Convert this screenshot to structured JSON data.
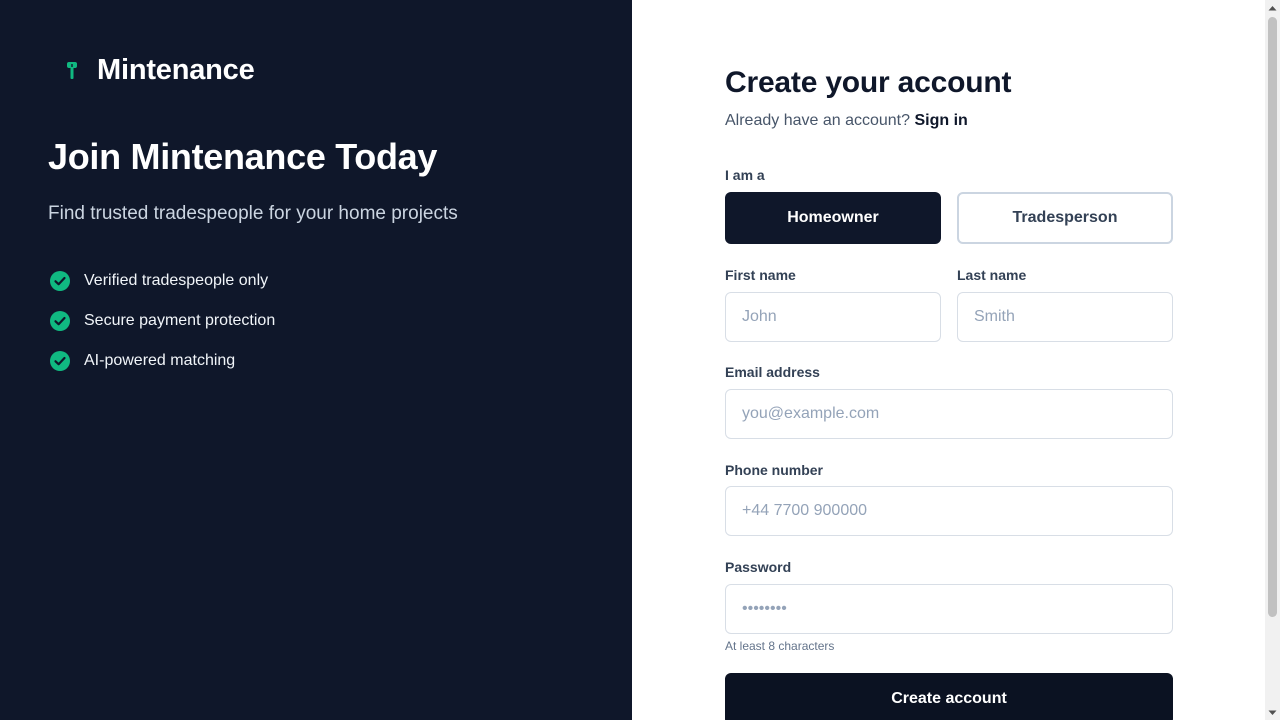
{
  "brand": {
    "name": "Mintenance",
    "icon": "wrench-icon",
    "accent": "#10b981"
  },
  "hero": {
    "title": "Join Mintenance Today",
    "subtitle": "Find trusted tradespeople for your home projects",
    "features": [
      {
        "text": "Verified tradespeople only",
        "icon": "check-circle-icon"
      },
      {
        "text": "Secure payment protection",
        "icon": "check-circle-icon"
      },
      {
        "text": "AI-powered matching",
        "icon": "check-circle-icon"
      }
    ]
  },
  "form": {
    "title": "Create your account",
    "signin_prompt": "Already have an account?",
    "signin_link": "Sign in",
    "role_label": "I am a",
    "roles": [
      {
        "label": "Homeowner",
        "selected": true
      },
      {
        "label": "Tradesperson",
        "selected": false
      }
    ],
    "first_name": {
      "label": "First name",
      "placeholder": "John",
      "value": ""
    },
    "last_name": {
      "label": "Last name",
      "placeholder": "Smith",
      "value": ""
    },
    "email": {
      "label": "Email address",
      "placeholder": "you@example.com",
      "value": ""
    },
    "phone": {
      "label": "Phone number",
      "placeholder": "+44 7700 900000",
      "value": ""
    },
    "password": {
      "label": "Password",
      "placeholder": "••••••••",
      "hint": "At least 8 characters"
    },
    "submit_label": "Create account"
  },
  "colors": {
    "sidebar_bg": "#0f172a",
    "primary": "#0f172a",
    "accent": "#10b981"
  }
}
